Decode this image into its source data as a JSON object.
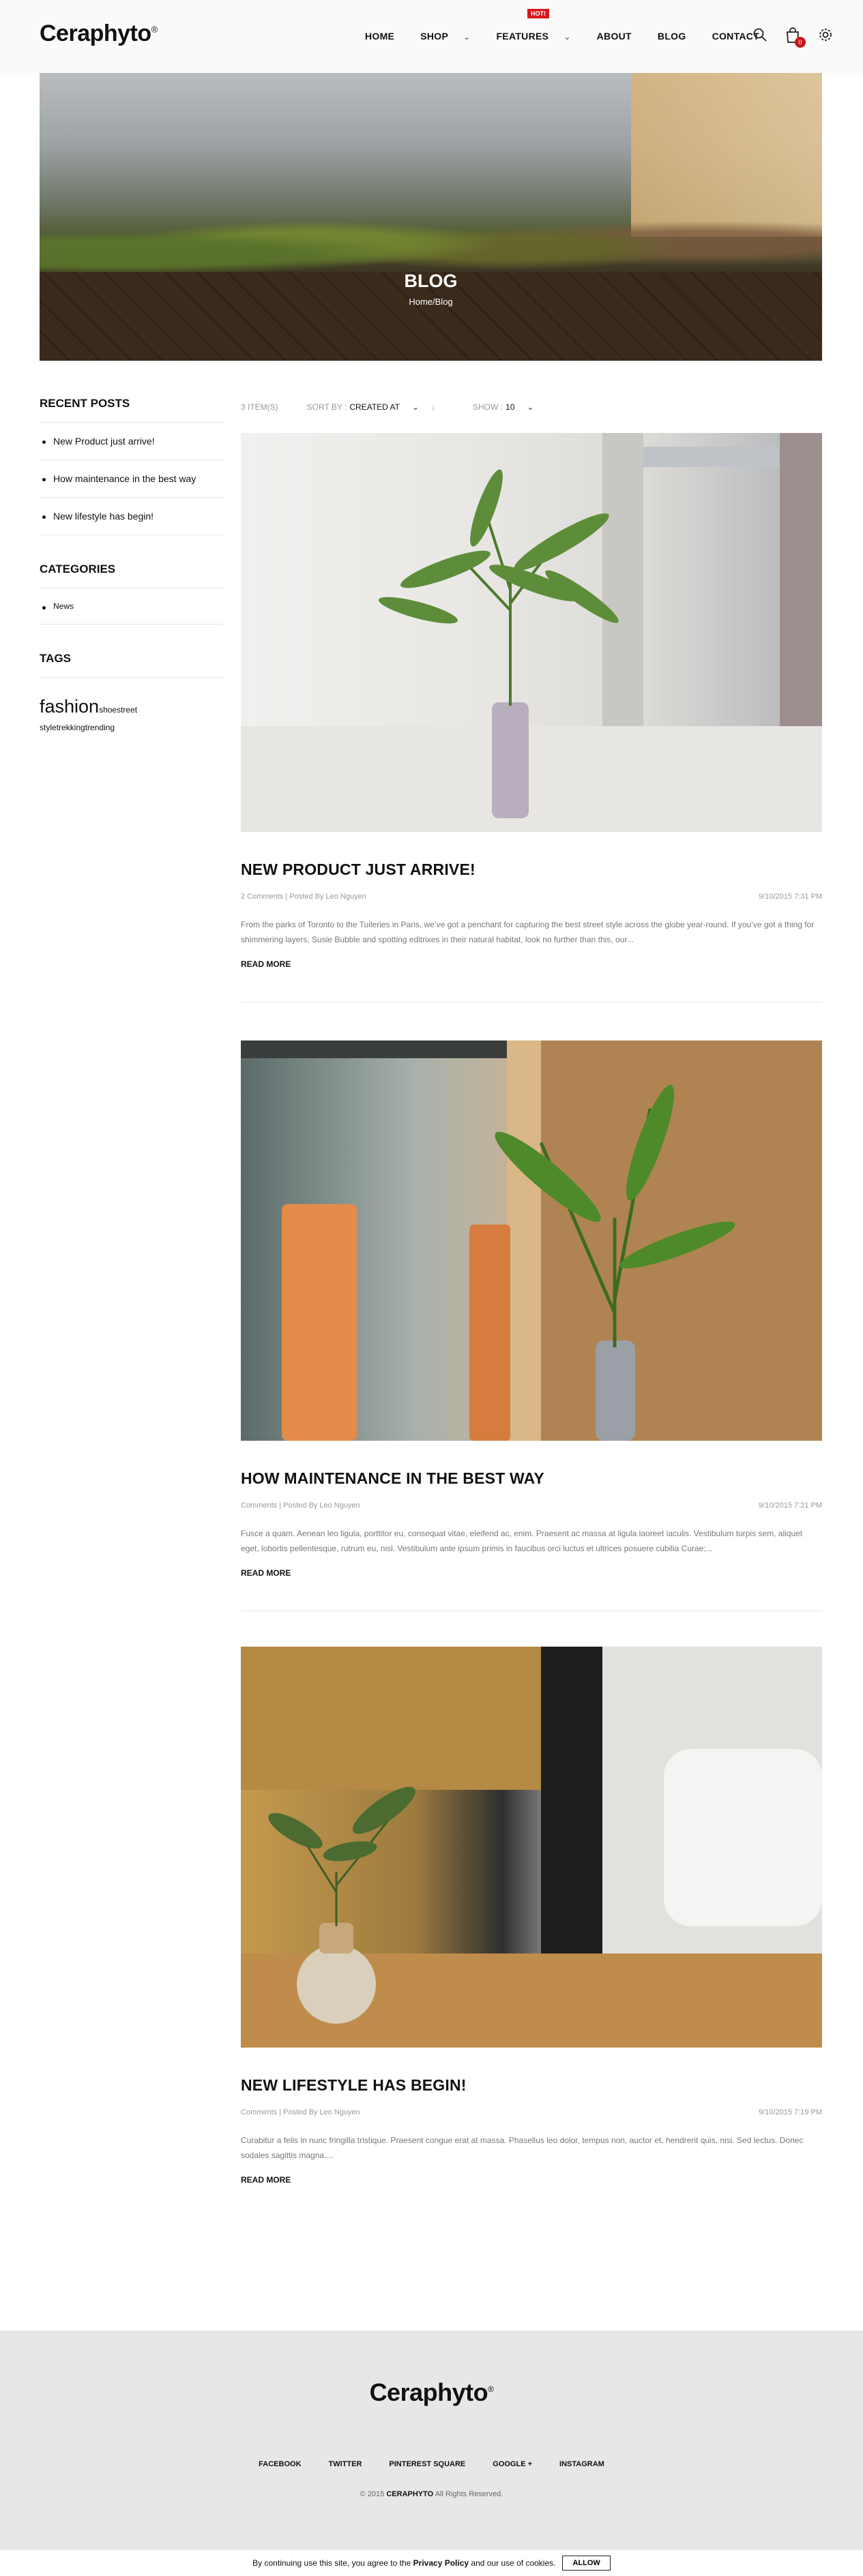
{
  "header": {
    "logo": "Ceraphyto",
    "logo_mark": "®",
    "nav": [
      {
        "label": "HOME"
      },
      {
        "label": "SHOP"
      },
      {
        "label": "FEATURES"
      },
      {
        "label": "ABOUT"
      },
      {
        "label": "BLOG"
      },
      {
        "label": "CONTACT"
      }
    ],
    "hot_badge": "HOT!",
    "cart_count": "0"
  },
  "hero": {
    "title": "BLOG",
    "breadcrumb": "Home/Blog"
  },
  "sidebar": {
    "recent_title": "RECENT POSTS",
    "recent": [
      "New Product just arrive!",
      "How maintenance in the best way",
      "New lifestyle has begin!"
    ],
    "categories_title": "CATEGORIES",
    "categories": [
      "News"
    ],
    "tags_title": "TAGS",
    "tags": [
      "fashion",
      "shoestreet",
      "style",
      "trekking",
      "trending"
    ]
  },
  "toolbar": {
    "items_count": "3 ITEM(S)",
    "sort_label": "SORT BY :",
    "sort_value": "CREATED AT",
    "show_label": "SHOW :",
    "show_value": "10"
  },
  "posts": [
    {
      "title": "NEW PRODUCT JUST ARRIVE!",
      "meta": "2 Comments | Posted By Leo Nguyen",
      "date": "9/10/2015 7:31 PM",
      "excerpt": "From the parks of Toronto to the Tuileries in Paris, we’ve got a penchant for capturing the best street style across the globe year-round. If you’ve got a thing for shimmering layers, Susie Bubble and spotting editrixes in their natural habitat, look no further than this, our...",
      "readmore": "READ MORE"
    },
    {
      "title": "HOW MAINTENANCE IN THE BEST WAY",
      "meta": "Comments | Posted By Leo Nguyen",
      "date": "9/10/2015 7:21 PM",
      "excerpt": "Fusce a quam. Aenean leo ligula, porttitor eu, consequat vitae, eleifend ac, enim. Praesent ac massa at ligula laoreet iaculis. Vestibulum turpis sem, aliquet eget, lobortis pellentesque, rutrum eu, nisl. Vestibulum ante ipsum primis in faucibus orci luctus et ultrices posuere cubilia Curae;...",
      "readmore": "READ MORE"
    },
    {
      "title": "NEW LIFESTYLE HAS BEGIN!",
      "meta": "Comments | Posted By Leo Nguyen",
      "date": "9/10/2015 7:19 PM",
      "excerpt": "Curabitur a felis in nunc fringilla tristique. Praesent congue erat at massa. Phasellus leo dolor, tempus non, auctor et, hendrerit quis, nisi. Sed lectus. Donec sodales sagittis magna....",
      "readmore": "READ MORE"
    }
  ],
  "footer": {
    "logo": "Ceraphyto",
    "logo_mark": "®",
    "links": [
      "FACEBOOK",
      "TWITTER",
      "PINTEREST SQUARE",
      "GOOGLE +",
      "INSTAGRAM"
    ],
    "copy_year": "© 2015",
    "copy_brand": "CERAPHYTO",
    "copy_rest": "All Rights Reserved."
  },
  "cookie": {
    "text_before": "By continuing use this site, you agree to the",
    "link": "Privacy Policy",
    "text_after": "and our use of cookies.",
    "button": "ALLOW"
  }
}
